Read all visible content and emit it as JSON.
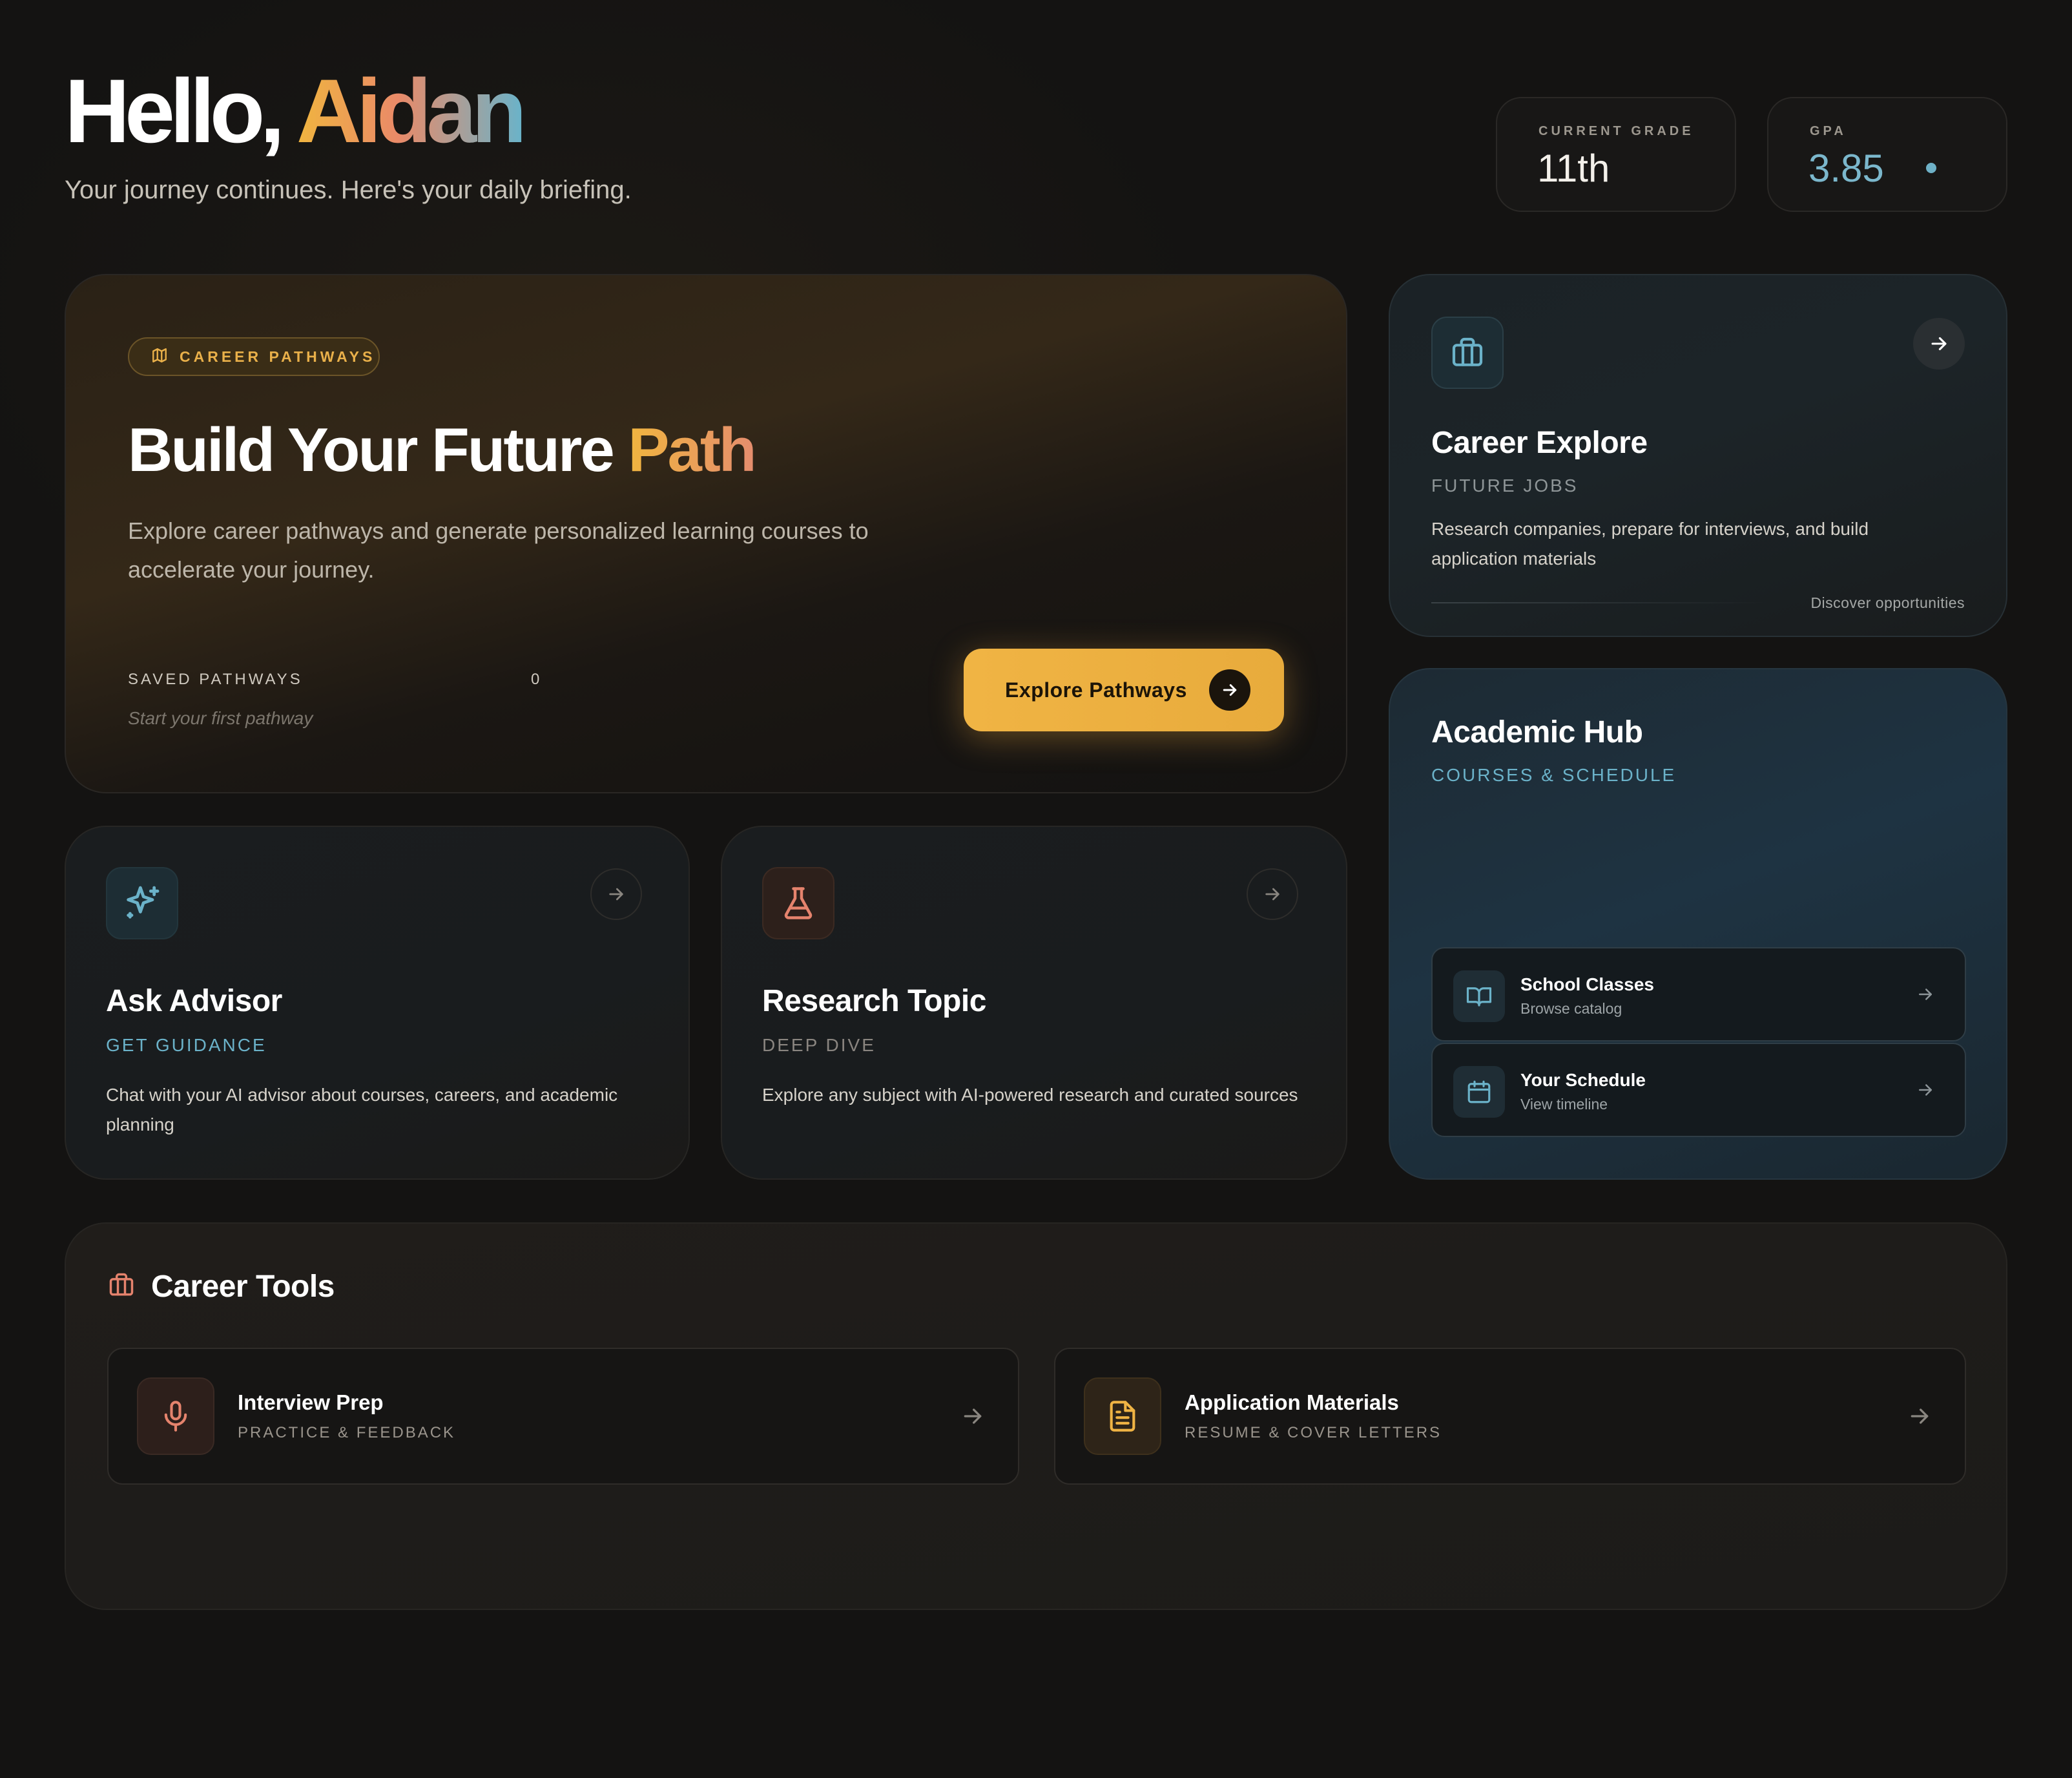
{
  "header": {
    "greeting_prefix": "Hello, ",
    "name": "Aidan",
    "subtitle": "Your journey continues. Here's your daily briefing."
  },
  "stats": {
    "grade_label": "CURRENT GRADE",
    "grade_value": "11th",
    "gpa_label": "GPA",
    "gpa_value": "3.85"
  },
  "hero": {
    "badge": "CAREER PATHWAYS",
    "title_main": "Build Your Future ",
    "title_accent": "Path",
    "description": "Explore career pathways and generate personalized learning courses to accelerate your journey.",
    "saved_label": "SAVED PATHWAYS",
    "saved_count": "0",
    "saved_hint": "Start your first pathway",
    "button_label": "Explore Pathways"
  },
  "career_explore": {
    "title": "Career Explore",
    "subtitle": "FUTURE JOBS",
    "description": "Research companies, prepare for interviews, and build application materials",
    "footer_link": "Discover opportunities"
  },
  "academic_hub": {
    "title": "Academic Hub",
    "subtitle": "COURSES & SCHEDULE",
    "links": [
      {
        "title": "School Classes",
        "subtitle": "Browse catalog",
        "icon": "book-icon"
      },
      {
        "title": "Your Schedule",
        "subtitle": "View timeline",
        "icon": "calendar-icon"
      }
    ]
  },
  "ask_advisor": {
    "title": "Ask Advisor",
    "subtitle": "GET GUIDANCE",
    "description": "Chat with your AI advisor about courses, careers, and academic planning"
  },
  "research_topic": {
    "title": "Research Topic",
    "subtitle": "DEEP DIVE",
    "description": "Explore any subject with AI-powered research and curated sources"
  },
  "career_tools": {
    "title": "Career Tools",
    "items": [
      {
        "title": "Interview Prep",
        "subtitle": "PRACTICE & FEEDBACK",
        "icon": "microphone-icon"
      },
      {
        "title": "Application Materials",
        "subtitle": "RESUME & COVER LETTERS",
        "icon": "document-icon"
      }
    ]
  },
  "colors": {
    "background": "#141312",
    "accent_gold": "#f0b444",
    "accent_coral": "#e58d6e",
    "accent_teal": "#6bb2c9"
  }
}
